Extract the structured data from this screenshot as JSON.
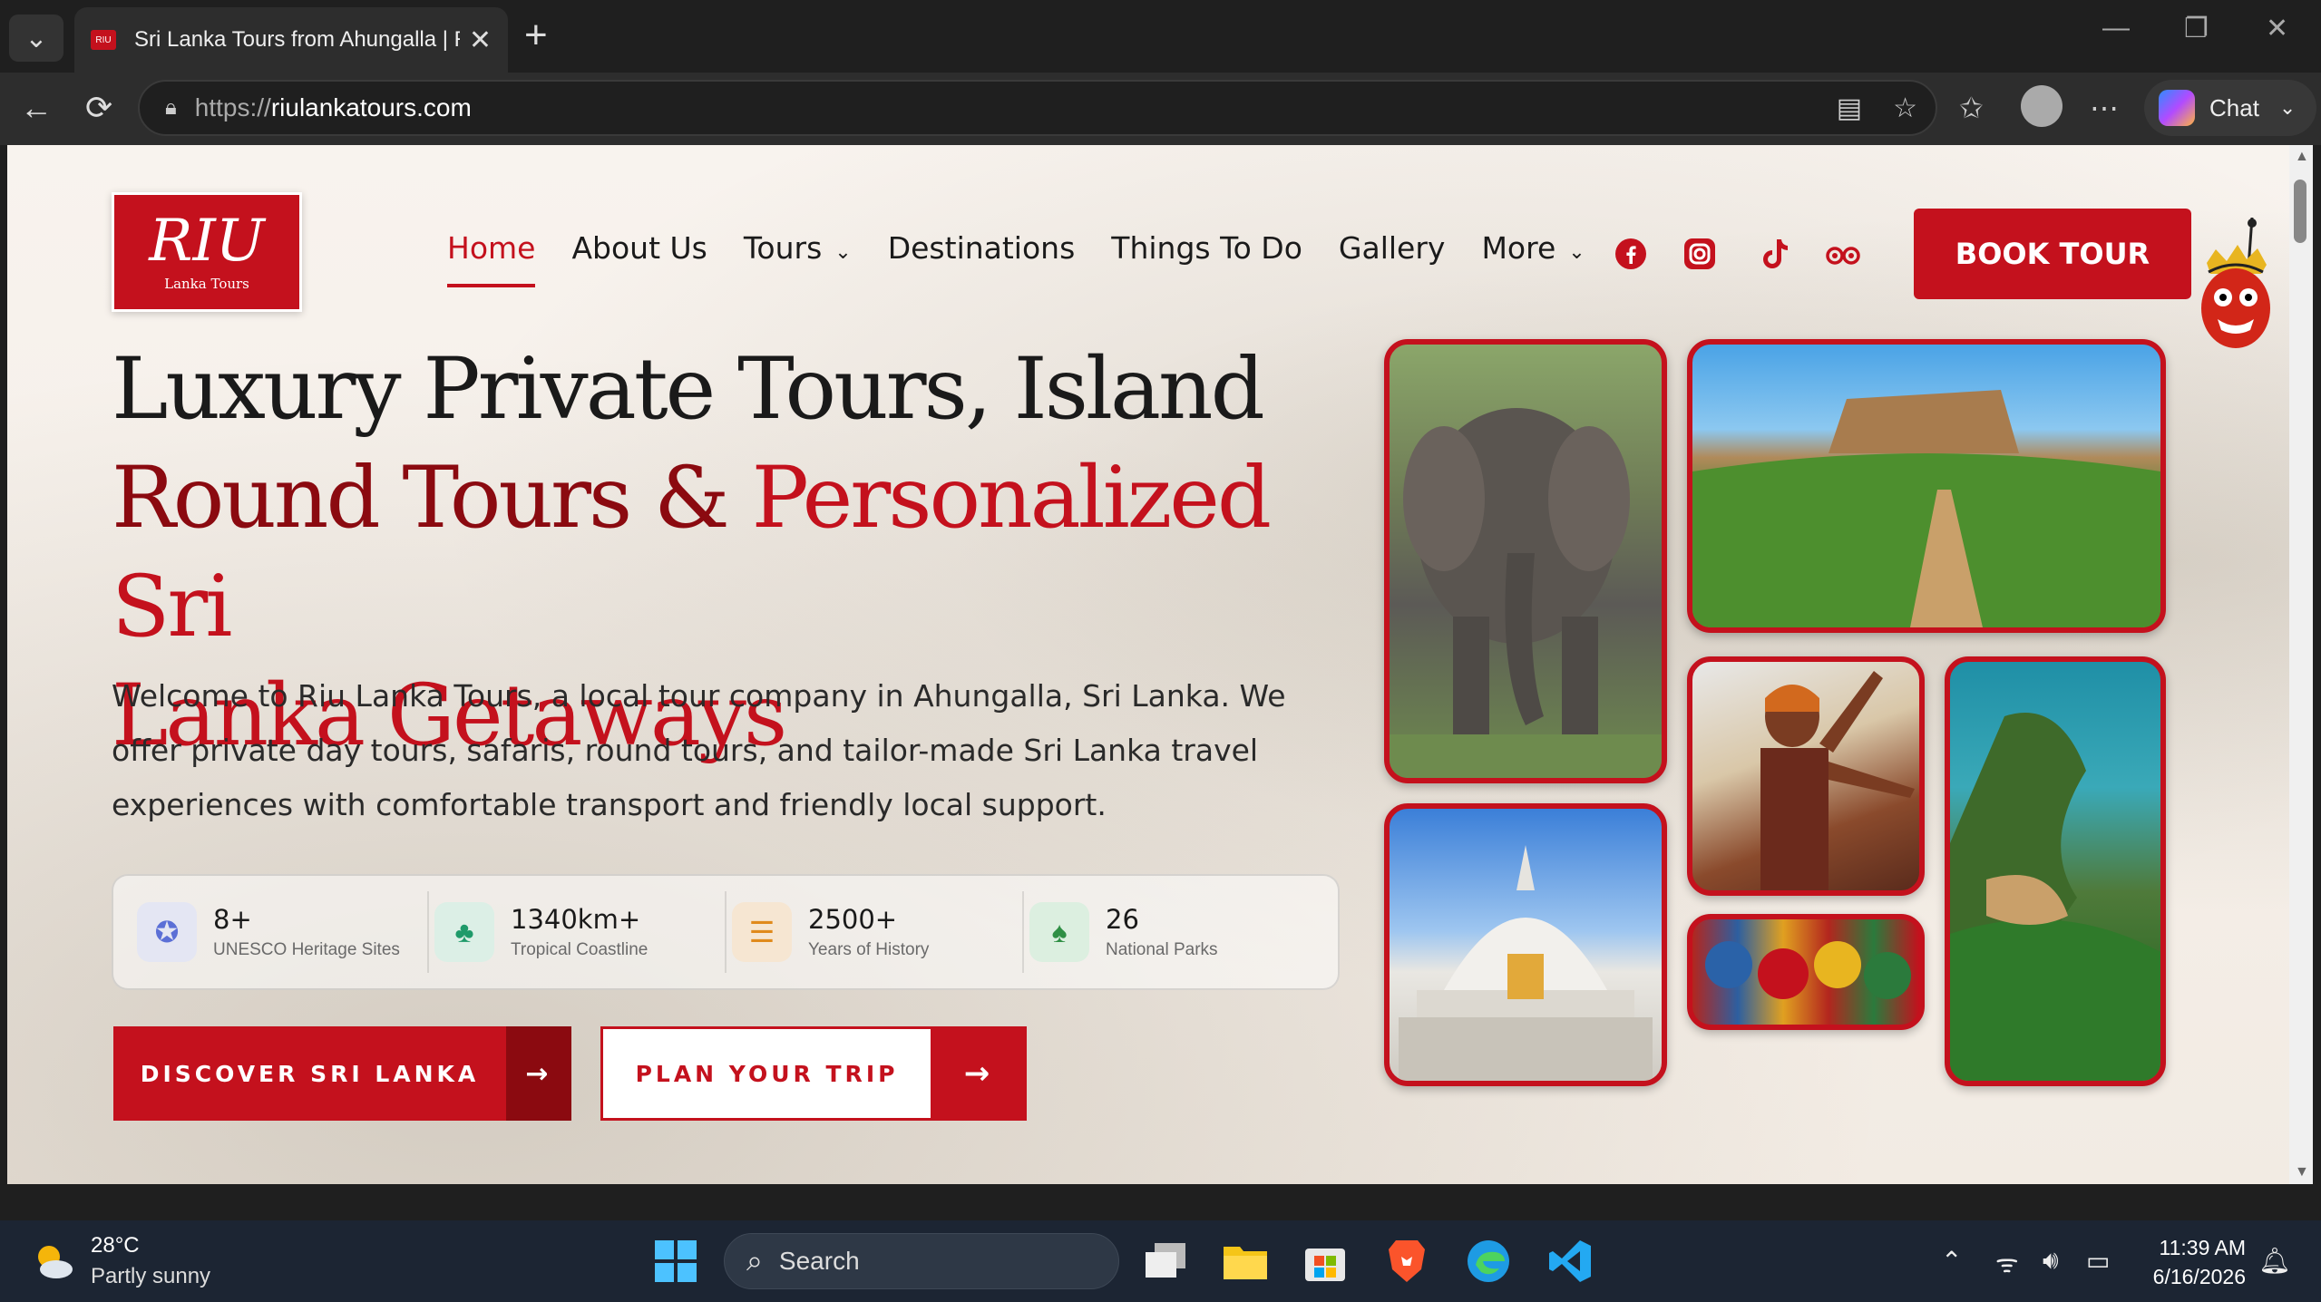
{
  "browser": {
    "tab_title": "Sri Lanka Tours from Ahungalla | R",
    "url_prefix": "https://",
    "url_domain": "riulankatours.com",
    "chat_label": "Chat"
  },
  "site": {
    "logo_main": "RIU",
    "logo_sub": "Lanka Tours",
    "nav": [
      "Home",
      "About Us",
      "Tours",
      "Destinations",
      "Things To Do",
      "Gallery",
      "More"
    ],
    "book_label": "BOOK TOUR",
    "hero": {
      "line1": "Luxury Private Tours, Island",
      "line2a": "Round Tours & ",
      "line2b": "Personalized Sri",
      "line3": "Lanka Getaways",
      "lead": "Welcome to Riu Lanka Tours, a local tour company in Ahungalla, Sri Lanka. We offer private day tours, safaris, round tours, and tailor-made Sri Lanka travel experiences with comfortable transport and friendly local support."
    },
    "stats": [
      {
        "value": "8+",
        "label": "UNESCO Heritage Sites"
      },
      {
        "value": "1340km+",
        "label": "Tropical Coastline"
      },
      {
        "value": "2500+",
        "label": "Years of History"
      },
      {
        "value": "26",
        "label": "National Parks"
      }
    ],
    "cta_primary": "DISCOVER SRI LANKA",
    "cta_secondary": "PLAN YOUR TRIP",
    "brand_color": "#c4111d"
  },
  "taskbar": {
    "temp": "28°C",
    "weather": "Partly sunny",
    "search_placeholder": "Search",
    "time": "11:39 AM",
    "date": "6/16/2026"
  }
}
